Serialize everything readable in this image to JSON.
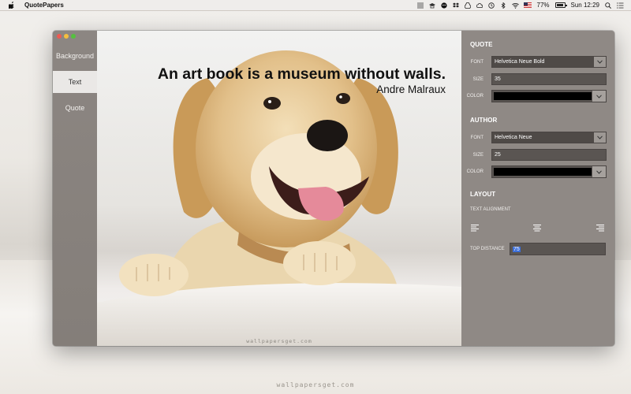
{
  "menubar": {
    "app_name": "QuotePapers",
    "battery_percent": "77%",
    "clock": "Sun 12:29",
    "icons": [
      "apple-icon",
      "menu-list-icon",
      "graduation-icon",
      "circle-icon",
      "dropbox-icon",
      "drive-icon",
      "cloud-icon",
      "time-machine-icon",
      "bluetooth-icon",
      "wifi-icon",
      "flag-icon",
      "battery-icon",
      "search-icon",
      "list-icon"
    ]
  },
  "sidebar": {
    "items": [
      {
        "label": "Background"
      },
      {
        "label": "Text"
      },
      {
        "label": "Quote"
      }
    ],
    "active": "Text"
  },
  "preview": {
    "quote": "An art book is a museum without walls.",
    "author": "Andre Malraux",
    "watermark": "wallpapersget.com"
  },
  "panel": {
    "quote_section": {
      "title": "QUOTE",
      "font_label": "FONT",
      "font_value": "Helvetica Neue Bold",
      "size_label": "SIZE",
      "size_value": "35",
      "color_label": "COLOR",
      "color_value": "#000000"
    },
    "author_section": {
      "title": "AUTHOR",
      "font_label": "FONT",
      "font_value": "Helvetica Neue",
      "size_label": "SIZE",
      "size_value": "25",
      "color_label": "COLOR",
      "color_value": "#000000"
    },
    "layout_section": {
      "title": "LAYOUT",
      "alignment_label": "TEXT ALIGNMENT",
      "alignment_options": [
        "left",
        "center",
        "right"
      ],
      "top_distance_label": "TOP DISTANCE",
      "top_distance_value": "75"
    }
  },
  "desktop": {
    "watermark": "wallpapersget.com"
  },
  "colors": {
    "panel_bg": "#8f8985",
    "sidebar_active_bg": "#eae8e6",
    "selection": "#3d6fd8"
  }
}
